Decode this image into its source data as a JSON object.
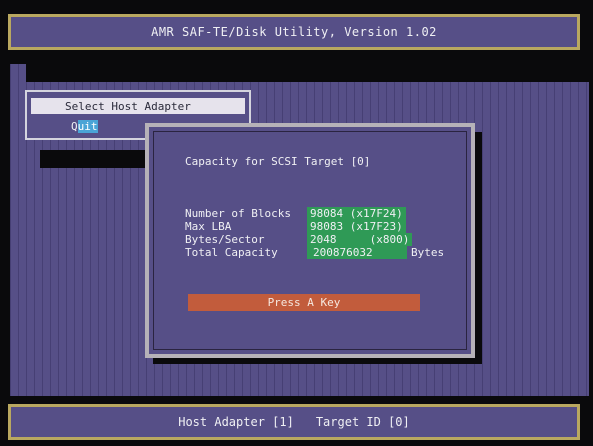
{
  "app": {
    "title": "AMR SAF-TE/Disk Utility, Version 1.02"
  },
  "menu": {
    "selected_item": "Select Host Adapter",
    "quit_hotkey": "Q",
    "quit_rest": "uit"
  },
  "dialog": {
    "title": "Capacity for SCSI Target [0]",
    "rows": [
      {
        "label": "Number of Blocks",
        "value": "98084 (x17F24)"
      },
      {
        "label": "Max LBA",
        "value": "98083 (x17F23)"
      },
      {
        "label": "Bytes/Sector",
        "value": "2048     (x800)"
      },
      {
        "label": "Total Capacity",
        "value": "200876032",
        "unit": "Bytes"
      }
    ],
    "press_key": "Press A Key"
  },
  "status": {
    "host_adapter": "Host Adapter [1]",
    "target_id": "Target ID [0]"
  },
  "colors": {
    "background": "#564f87",
    "frame": "#b9a860",
    "value_highlight": "#2f9a56",
    "prompt": "#c25c3c",
    "menu_highlight": "#e6e3ec",
    "hotkey": "#4aa4d6"
  }
}
